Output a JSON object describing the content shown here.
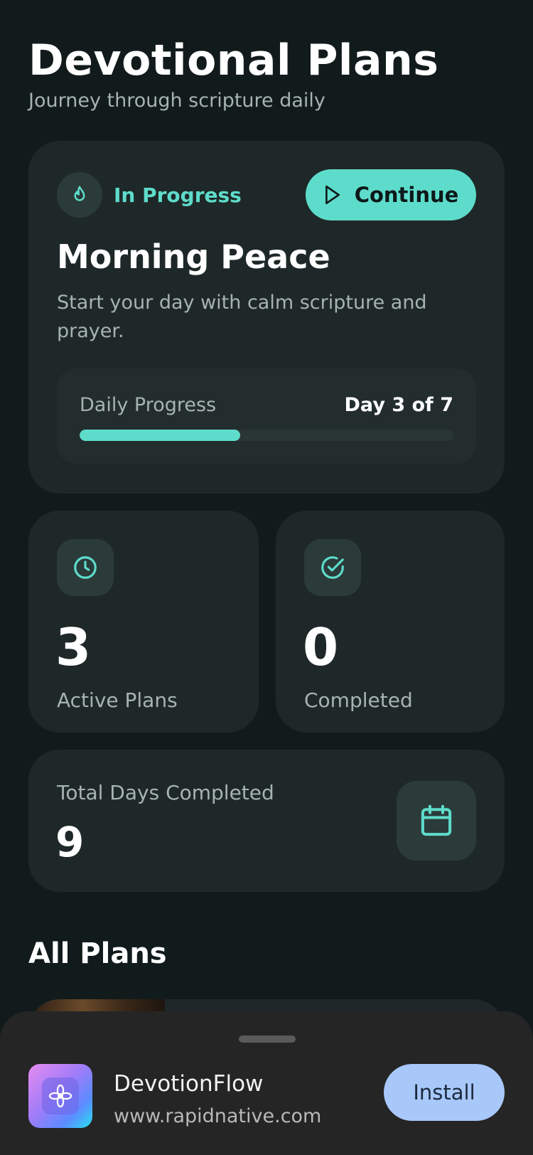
{
  "header": {
    "title": "Devotional Plans",
    "subtitle": "Journey through scripture daily"
  },
  "current_plan": {
    "status_label": "In Progress",
    "status_icon": "flame-icon",
    "continue_label": "Continue",
    "continue_icon": "play-icon",
    "title": "Morning Peace",
    "description": "Start your day with calm scripture and prayer.",
    "progress_label": "Daily Progress",
    "progress_text": "Day 3 of 7",
    "progress_fraction": 0.43
  },
  "stats": {
    "active": {
      "value": "3",
      "label": "Active Plans",
      "icon": "clock-icon"
    },
    "completed": {
      "value": "0",
      "label": "Completed",
      "icon": "check-circle-icon"
    }
  },
  "total_days": {
    "label": "Total Days Completed",
    "value": "9",
    "icon": "calendar-icon"
  },
  "all_plans": {
    "title": "All Plans"
  },
  "install_banner": {
    "app_name": "DevotionFlow",
    "url": "www.rapidnative.com",
    "install_label": "Install",
    "app_icon": "lotus-icon"
  },
  "colors": {
    "background": "#121b1b",
    "card": "#1f2828",
    "accent": "#5edccb",
    "muted_text": "#a6b3b1",
    "install_button": "#a8c8fa"
  }
}
